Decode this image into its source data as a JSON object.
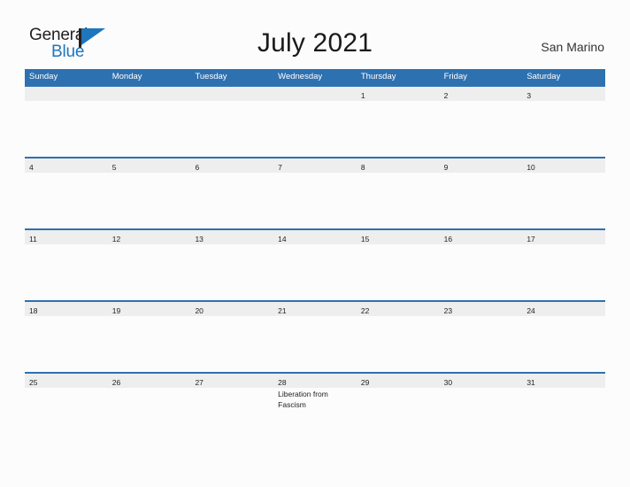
{
  "brand": {
    "name_part1": "General",
    "name_part2": "Blue",
    "accent_color": "#1e76bd"
  },
  "header": {
    "title": "July 2021",
    "region": "San Marino"
  },
  "colors": {
    "header_blue": "#2e71b0",
    "date_band_gray": "#eeeeee",
    "page_background": "#fcfcfc"
  },
  "calendar": {
    "weekdays": [
      "Sunday",
      "Monday",
      "Tuesday",
      "Wednesday",
      "Thursday",
      "Friday",
      "Saturday"
    ],
    "weeks": [
      {
        "days": [
          {
            "number": "",
            "events": []
          },
          {
            "number": "",
            "events": []
          },
          {
            "number": "",
            "events": []
          },
          {
            "number": "",
            "events": []
          },
          {
            "number": "1",
            "events": []
          },
          {
            "number": "2",
            "events": []
          },
          {
            "number": "3",
            "events": []
          }
        ]
      },
      {
        "days": [
          {
            "number": "4",
            "events": []
          },
          {
            "number": "5",
            "events": []
          },
          {
            "number": "6",
            "events": []
          },
          {
            "number": "7",
            "events": []
          },
          {
            "number": "8",
            "events": []
          },
          {
            "number": "9",
            "events": []
          },
          {
            "number": "10",
            "events": []
          }
        ]
      },
      {
        "days": [
          {
            "number": "11",
            "events": []
          },
          {
            "number": "12",
            "events": []
          },
          {
            "number": "13",
            "events": []
          },
          {
            "number": "14",
            "events": []
          },
          {
            "number": "15",
            "events": []
          },
          {
            "number": "16",
            "events": []
          },
          {
            "number": "17",
            "events": []
          }
        ]
      },
      {
        "days": [
          {
            "number": "18",
            "events": []
          },
          {
            "number": "19",
            "events": []
          },
          {
            "number": "20",
            "events": []
          },
          {
            "number": "21",
            "events": []
          },
          {
            "number": "22",
            "events": []
          },
          {
            "number": "23",
            "events": []
          },
          {
            "number": "24",
            "events": []
          }
        ]
      },
      {
        "days": [
          {
            "number": "25",
            "events": []
          },
          {
            "number": "26",
            "events": []
          },
          {
            "number": "27",
            "events": []
          },
          {
            "number": "28",
            "events": [
              "Liberation from Fascism"
            ]
          },
          {
            "number": "29",
            "events": []
          },
          {
            "number": "30",
            "events": []
          },
          {
            "number": "31",
            "events": []
          }
        ]
      }
    ]
  }
}
